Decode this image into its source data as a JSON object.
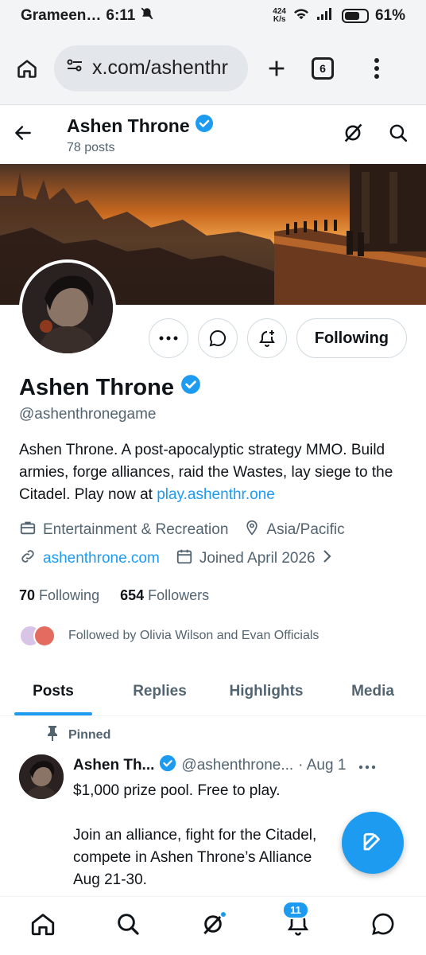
{
  "status_bar": {
    "carrier": "Grameen…",
    "time": "6:11",
    "net_speed_value": "424",
    "net_speed_unit": "K/s",
    "battery": "61%"
  },
  "browser": {
    "url": "x.com/ashenthr",
    "tab_count": "6"
  },
  "header": {
    "name": "Ashen Throne",
    "posts_count": "78 posts"
  },
  "profile": {
    "name": "Ashen Throne",
    "handle": "@ashenthronegame",
    "bio_text": "Ashen Throne. A post-apocalyptic strategy MMO. Build armies, forge alliances, raid the Wastes, lay siege to the Citadel. Play now at ",
    "bio_link": "play.ashenthr.one",
    "category": "Entertainment & Recreation",
    "location": "Asia/Pacific",
    "website": "ashenthrone.com",
    "joined": "Joined April 2026",
    "following_count": "70",
    "following_label": "Following",
    "followers_count": "654",
    "followers_label": "Followers",
    "followed_by": "Followed by Olivia Wilson and Evan Officials",
    "following_button": "Following"
  },
  "tabs": [
    "Posts",
    "Replies",
    "Highlights",
    "Media"
  ],
  "pinned_tweet": {
    "pinned_label": "Pinned",
    "name": "Ashen Th...",
    "handle": "@ashenthrone...",
    "date": "· Aug 1",
    "text": "$1,000 prize pool. Free to play.\n\nJoin an alliance, fight for the Citadel,\ncompete in Ashen Throne’s Alliance\nAug 21-30."
  },
  "bottom_nav": {
    "notifications_badge": "11"
  },
  "colors": {
    "accent": "#1d9bf0",
    "text_primary": "#0f1419",
    "text_secondary": "#536471"
  }
}
